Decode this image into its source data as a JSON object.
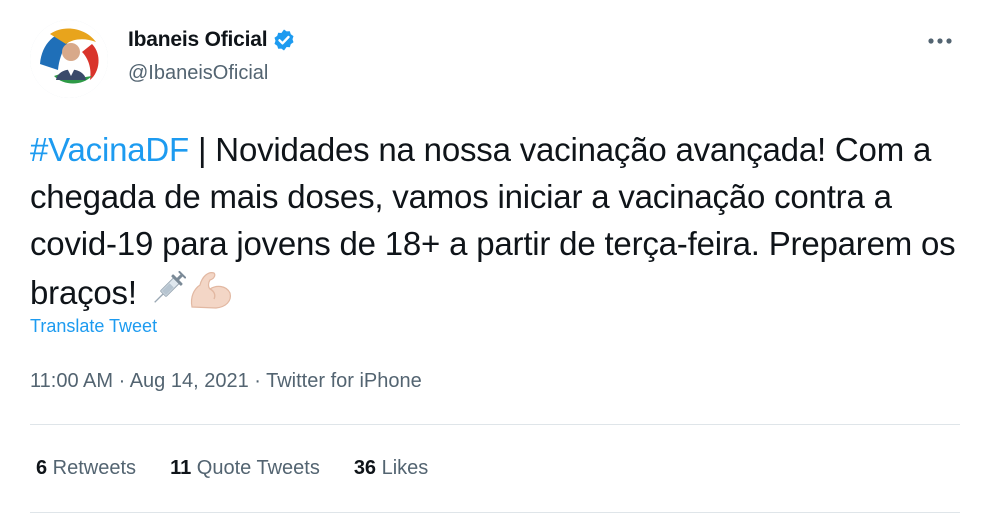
{
  "author": {
    "display_name": "Ibaneis Oficial",
    "handle": "@IbaneisOficial",
    "verified_icon": "verified-badge-icon",
    "avatar_icon": "profile-avatar"
  },
  "tweet": {
    "hashtag": "#VacinaDF",
    "body": " | Novidades na nossa vacinação avançada! Com a chegada de mais doses, vamos iniciar a vacinação contra a covid-19 para jovens de 18+ a partir de terça-feira. Preparem os braços! ",
    "emojis": [
      "syringe-emoji",
      "flexed-biceps-emoji"
    ],
    "translate_label": "Translate Tweet"
  },
  "meta": {
    "time": "11:00 AM",
    "separator1": " · ",
    "date": "Aug 14, 2021",
    "separator2": " · ",
    "source": "Twitter for iPhone"
  },
  "stats": {
    "retweets_count": "6",
    "retweets_label": " Retweets",
    "quotes_count": "11",
    "quotes_label": " Quote Tweets",
    "likes_count": "36",
    "likes_label": " Likes"
  },
  "colors": {
    "accent": "#1d9bf0",
    "text": "#0f1419",
    "secondary": "#536471",
    "divider": "#dfe5e9"
  }
}
